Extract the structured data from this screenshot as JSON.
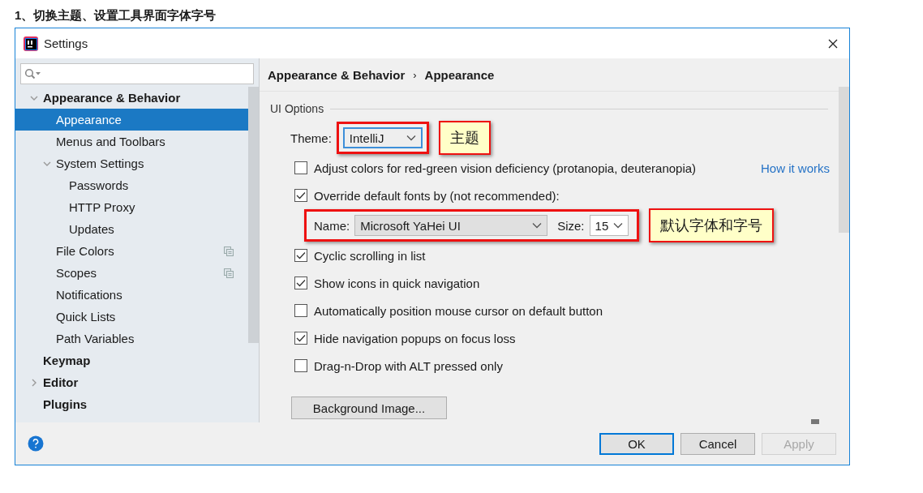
{
  "heading": "1、切换主题、设置工具界面字体字号",
  "window": {
    "title": "Settings"
  },
  "sidebar": {
    "items": [
      {
        "label": "Appearance & Behavior",
        "expanded": true,
        "selected": false,
        "children": [
          {
            "label": "Appearance",
            "selected": true
          },
          {
            "label": "Menus and Toolbars",
            "selected": false
          },
          {
            "label": "System Settings",
            "expanded": true,
            "selected": false,
            "children": [
              {
                "label": "Passwords",
                "selected": false
              },
              {
                "label": "HTTP Proxy",
                "selected": false
              },
              {
                "label": "Updates",
                "selected": false
              }
            ]
          },
          {
            "label": "File Colors",
            "selected": false,
            "project_scoped": true
          },
          {
            "label": "Scopes",
            "selected": false,
            "project_scoped": true
          },
          {
            "label": "Notifications",
            "selected": false
          },
          {
            "label": "Quick Lists",
            "selected": false
          },
          {
            "label": "Path Variables",
            "selected": false
          }
        ]
      },
      {
        "label": "Keymap",
        "selected": false
      },
      {
        "label": "Editor",
        "expanded": false,
        "selected": false
      },
      {
        "label": "Plugins",
        "selected": false
      }
    ]
  },
  "breadcrumb": {
    "items": [
      "Appearance & Behavior",
      "Appearance"
    ],
    "separator": "›"
  },
  "section": {
    "title": "UI Options",
    "theme": {
      "label": "Theme:",
      "value": "IntelliJ",
      "highlighted": true,
      "callout": "主题"
    },
    "options": [
      {
        "kind": "checkbox",
        "label": "Adjust colors for red-green vision deficiency (protanopia, deuteranopia)",
        "checked": false,
        "link": "How it works"
      },
      {
        "kind": "checkbox",
        "label": "Override default fonts by (not recommended):",
        "checked": true
      },
      {
        "kind": "font",
        "name_label": "Name:",
        "name_value": "Microsoft YaHei UI",
        "size_label": "Size:",
        "size_value": "15",
        "highlighted": true,
        "callout": "默认字体和字号"
      },
      {
        "kind": "checkbox",
        "label": "Cyclic scrolling in list",
        "checked": true
      },
      {
        "kind": "checkbox",
        "label": "Show icons in quick navigation",
        "checked": true
      },
      {
        "kind": "checkbox",
        "label": "Automatically position mouse cursor on default button",
        "checked": false
      },
      {
        "kind": "checkbox",
        "label": "Hide navigation popups on focus loss",
        "checked": true
      },
      {
        "kind": "checkbox",
        "label": "Drag-n-Drop with ALT pressed only",
        "checked": false
      }
    ],
    "button": "Background Image..."
  },
  "footer": {
    "buttons": [
      {
        "label": "OK",
        "default": true,
        "disabled": false
      },
      {
        "label": "Cancel",
        "default": false,
        "disabled": false
      },
      {
        "label": "Apply",
        "default": false,
        "disabled": true
      }
    ]
  }
}
